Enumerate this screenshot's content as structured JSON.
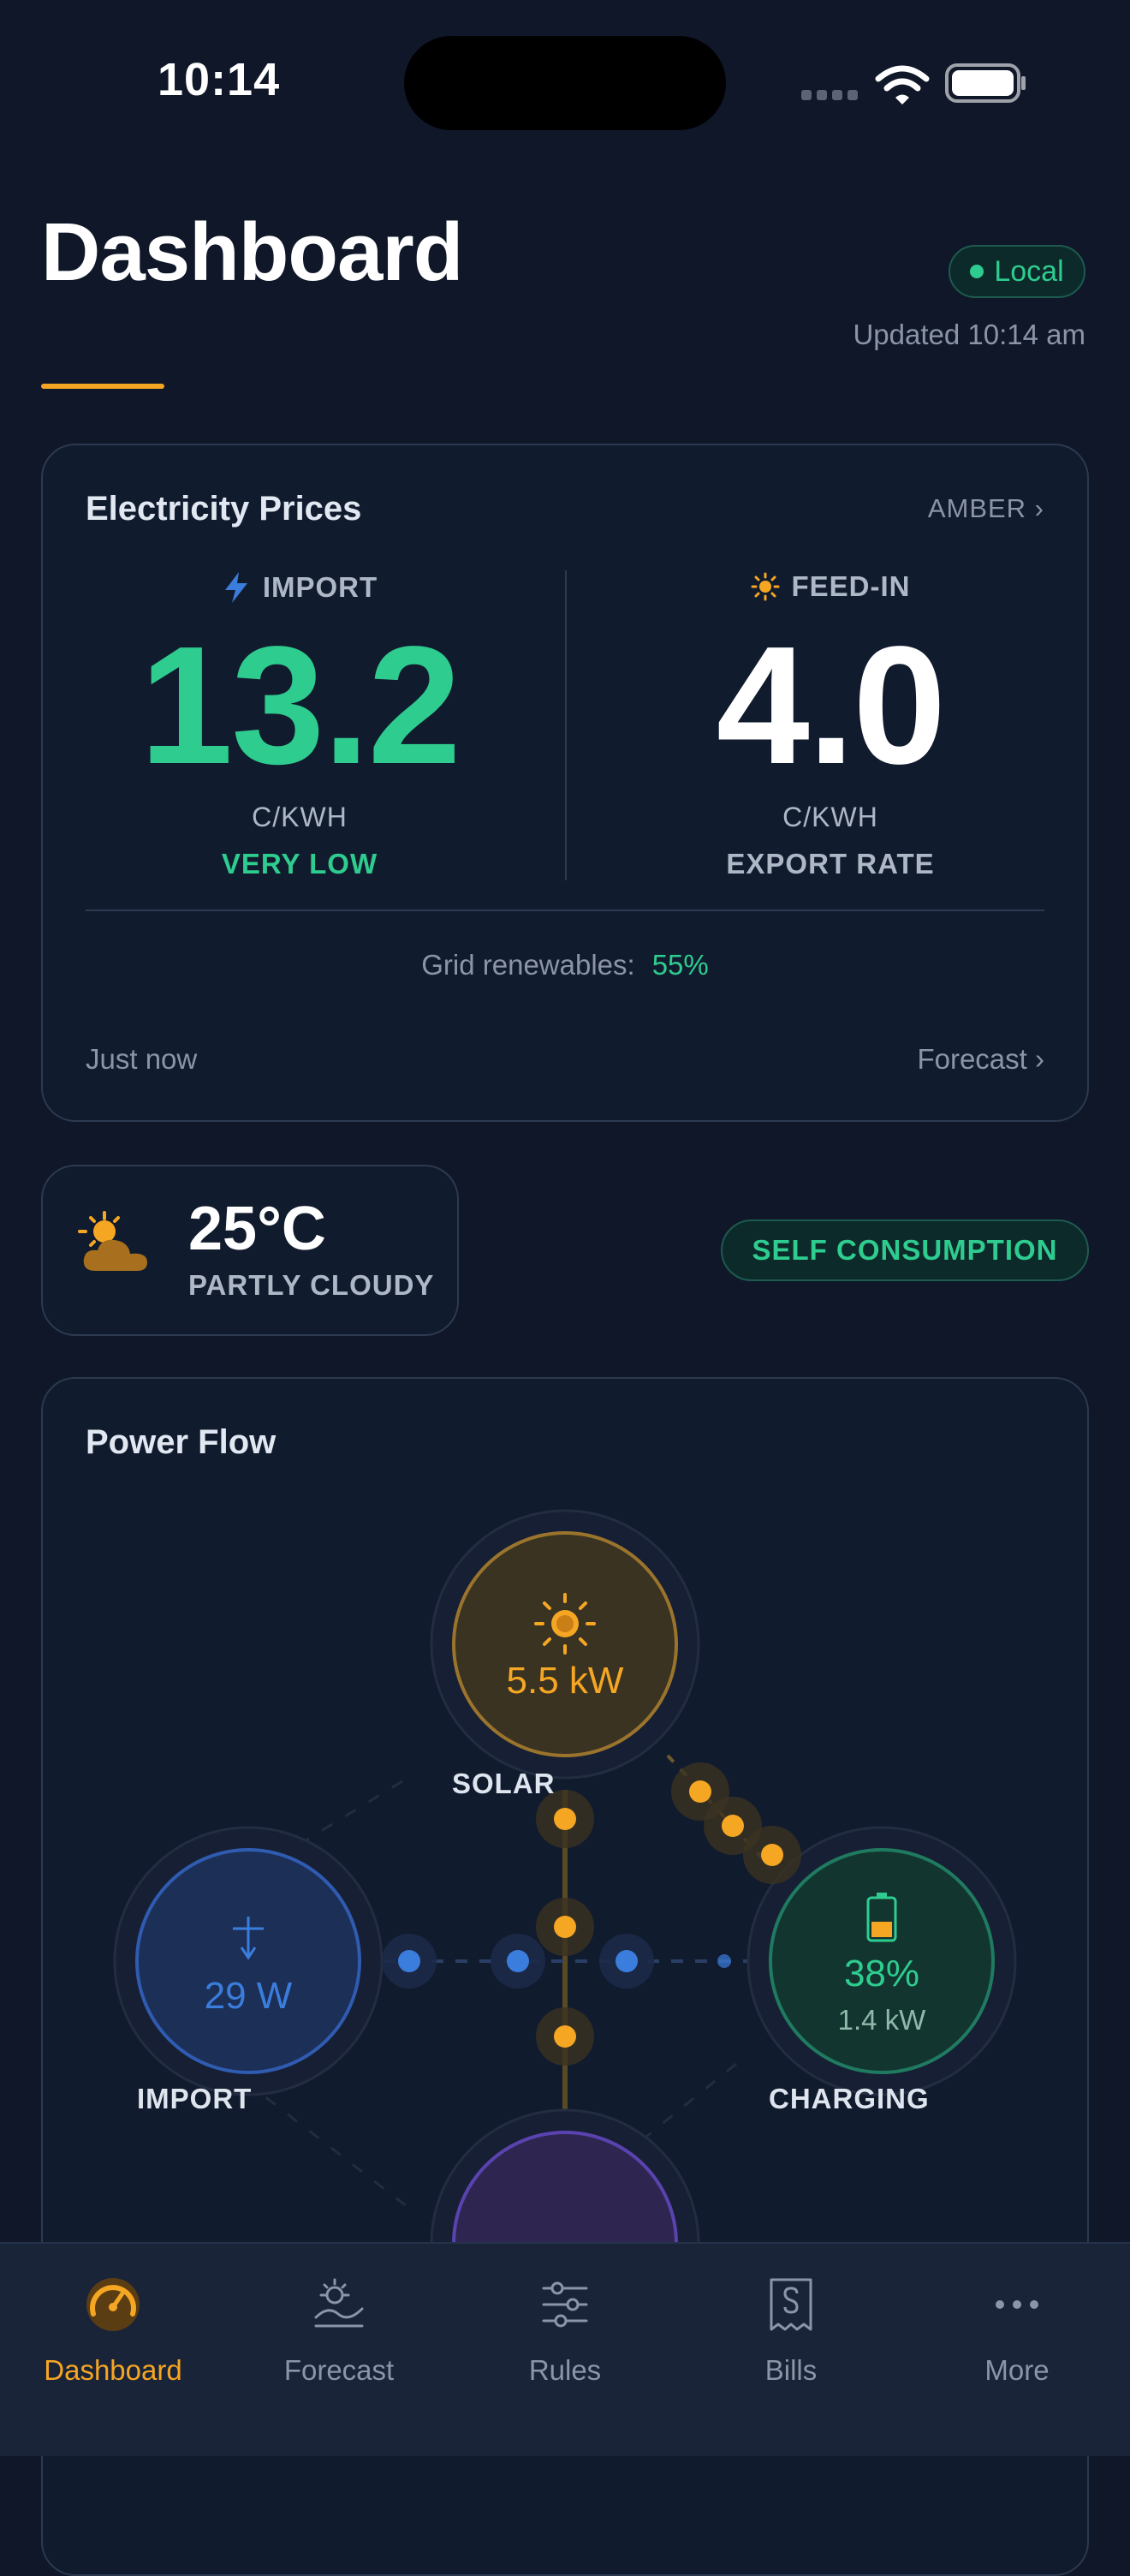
{
  "status_bar": {
    "time": "10:14"
  },
  "header": {
    "title": "Dashboard",
    "connection_badge": "Local",
    "updated": "Updated 10:14 am"
  },
  "prices": {
    "title": "Electricity Prices",
    "provider": "AMBER ›",
    "import": {
      "label": "IMPORT",
      "value": "13.2",
      "unit": "C/KWH",
      "status": "VERY LOW"
    },
    "feed_in": {
      "label": "FEED-IN",
      "value": "4.0",
      "unit": "C/KWH",
      "status": "EXPORT RATE"
    },
    "renewables_label": "Grid renewables:",
    "renewables_value": "55%",
    "refreshed": "Just now",
    "forecast_link": "Forecast ›"
  },
  "weather": {
    "temperature": "25°C",
    "condition": "PARTLY CLOUDY"
  },
  "mode_badge": "SELF CONSUMPTION",
  "power_flow": {
    "title": "Power Flow",
    "solar": {
      "value": "5.5 kW",
      "label": "SOLAR"
    },
    "grid": {
      "value": "29 W",
      "label": "IMPORT"
    },
    "battery": {
      "percent": "38%",
      "power": "1.4 kW",
      "label": "CHARGING"
    }
  },
  "colors": {
    "accent": "#f5a623",
    "green": "#2ecc8f",
    "blue": "#3b7ddd",
    "background": "#0f1729"
  },
  "tabs": [
    {
      "label": "Dashboard",
      "icon": "gauge-icon",
      "active": true
    },
    {
      "label": "Forecast",
      "icon": "sun-forecast-icon",
      "active": false
    },
    {
      "label": "Rules",
      "icon": "sliders-icon",
      "active": false
    },
    {
      "label": "Bills",
      "icon": "receipt-icon",
      "active": false
    },
    {
      "label": "More",
      "icon": "more-icon",
      "active": false
    }
  ]
}
